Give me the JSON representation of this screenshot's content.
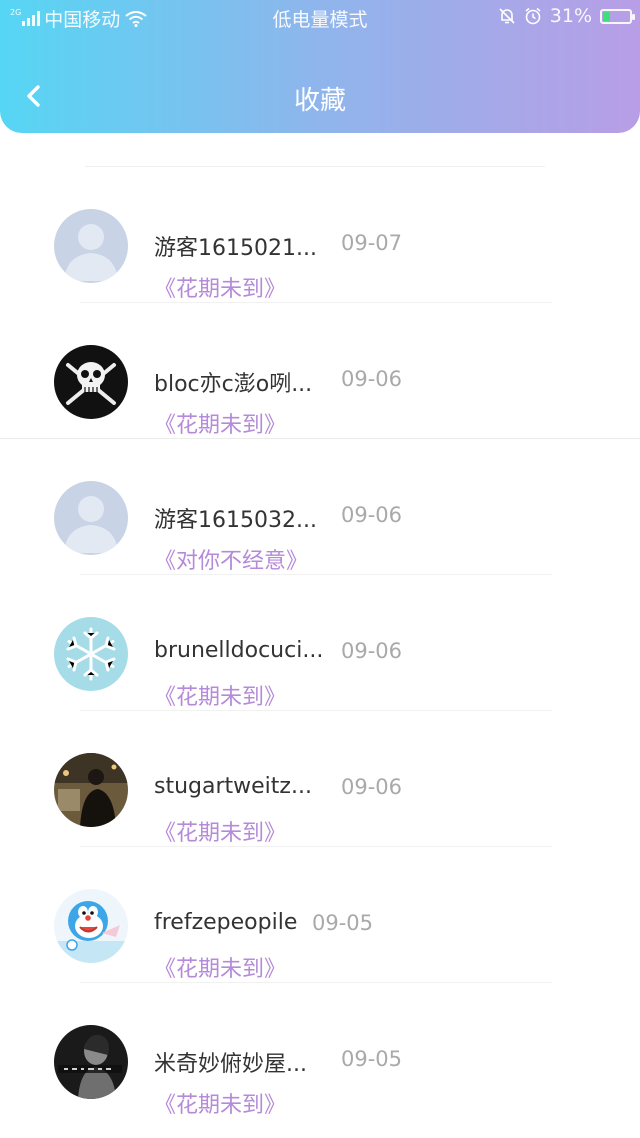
{
  "status_bar": {
    "network": "2G",
    "carrier": "中国移动",
    "mode": "低电量模式",
    "battery": "31%",
    "battery_level": 0.31
  },
  "header": {
    "title": "收藏"
  },
  "colors": {
    "gradient_start": "#56d6f4",
    "gradient_end": "#b89ee6",
    "song_color": "#b58ad8"
  },
  "items": [
    {
      "name": "游客1615021...",
      "date": "09-07",
      "song": "《花期未到》",
      "avatar": "default-avatar"
    },
    {
      "name": "bloc亦c澎o咧...",
      "date": "09-06",
      "song": "《花期未到》",
      "avatar": "skull-avatar"
    },
    {
      "name": "游客1615032...",
      "date": "09-06",
      "song": "《对你不经意》",
      "avatar": "default-avatar"
    },
    {
      "name": "brunelldocuci...",
      "date": "09-06",
      "song": "《花期未到》",
      "avatar": "snowflake-avatar"
    },
    {
      "name": "stugartweitz...",
      "date": "09-06",
      "song": "《花期未到》",
      "avatar": "photo-avatar"
    },
    {
      "name": "frefzepeopile",
      "date": "09-05",
      "song": "《花期未到》",
      "avatar": "cartoon-avatar"
    },
    {
      "name": "米奇妙俯妙屋...",
      "date": "09-05",
      "song": "《花期未到》",
      "avatar": "bw-photo-avatar"
    }
  ]
}
